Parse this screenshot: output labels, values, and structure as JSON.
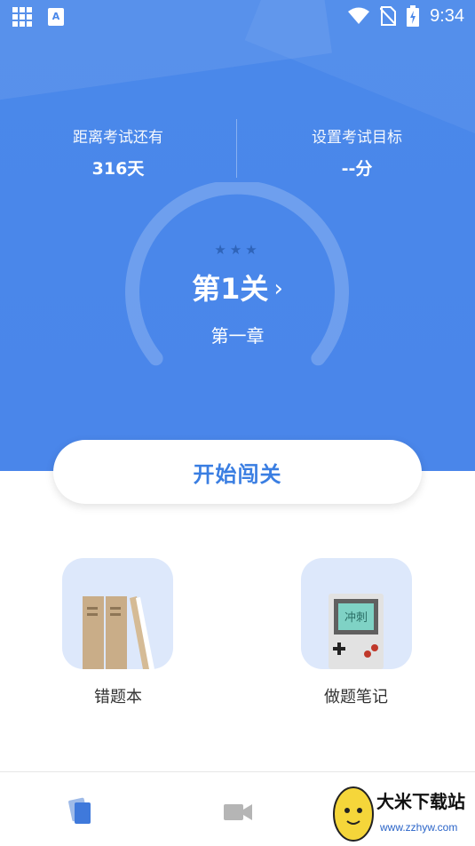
{
  "status_bar": {
    "time": "9:34",
    "app_badge": "A"
  },
  "exam": {
    "countdown_label": "距离考试还有",
    "countdown_value": "316天",
    "goal_label": "设置考试目标",
    "goal_value": "--分"
  },
  "level": {
    "stars": "★★★",
    "title": "第1关",
    "chapter": "第一章"
  },
  "actions": {
    "start_label": "开始闯关"
  },
  "tiles": [
    {
      "label": "错题本",
      "icon": "books-icon"
    },
    {
      "label": "做题笔记",
      "icon": "gameboy-icon",
      "screen_text": "冲刺"
    }
  ],
  "bottom_nav": [
    {
      "icon": "cards-icon",
      "active": true
    },
    {
      "icon": "video-camera-icon",
      "active": false
    }
  ],
  "watermark": {
    "title": "大米下载站",
    "url": "www.zzhyw.com"
  },
  "colors": {
    "primary": "#4a88ea",
    "accent_text": "#3a7ee2",
    "tile_bg": "#dde8fb"
  }
}
